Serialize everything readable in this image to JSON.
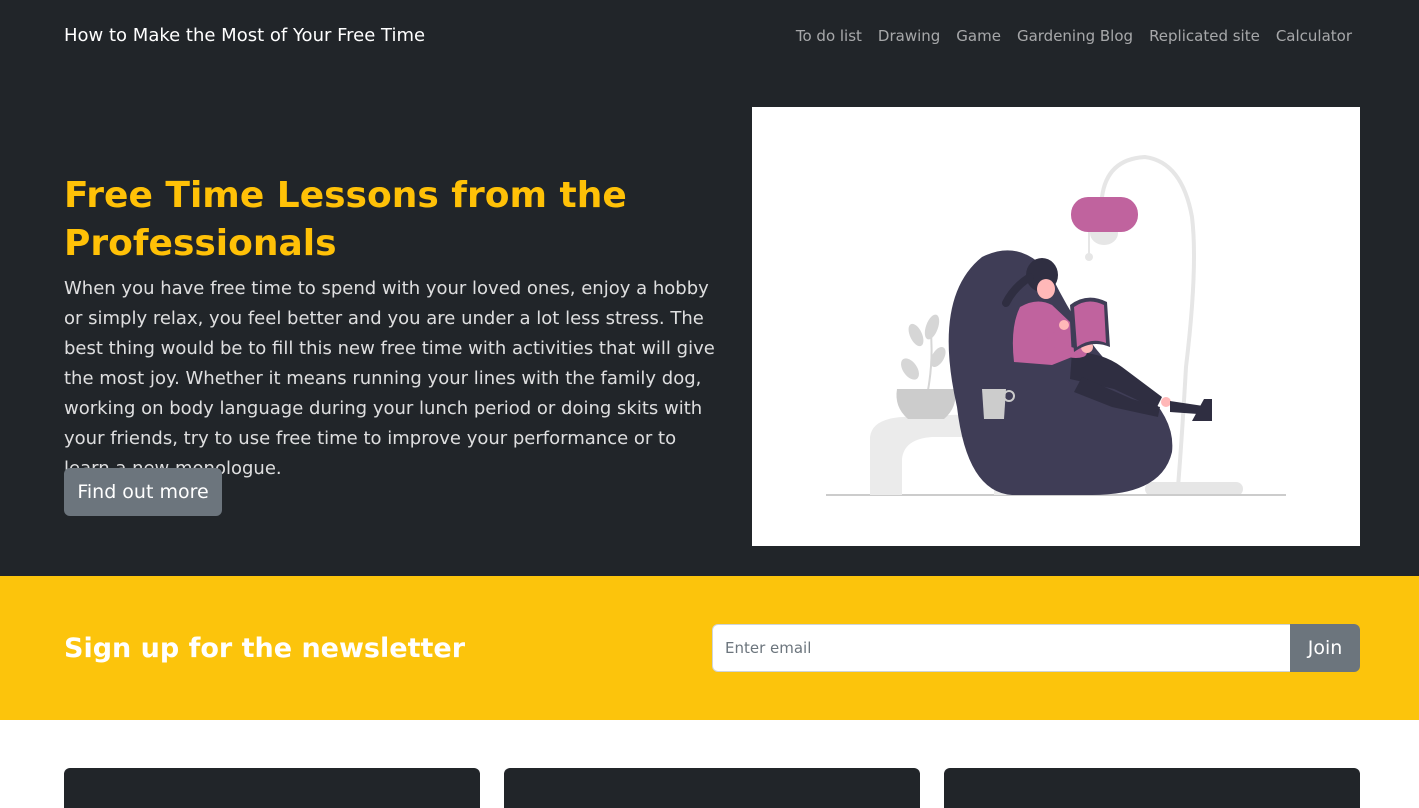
{
  "navbar": {
    "brand": "How to Make the Most of Your Free Time",
    "links": [
      "To do list",
      "Drawing",
      "Game",
      "Gardening Blog",
      "Replicated site",
      "Calculator"
    ]
  },
  "hero": {
    "title": "Free Time Lessons from the Professionals",
    "text": "When you have free time to spend with your loved ones, enjoy a hobby or simply relax, you feel better and you are under a lot less stress. The best thing would be to fill this new free time with activities that will give the most joy. Whether it means running your lines with the family dog, working on body language during your lunch period or doing skits with your friends, try to use free time to improve your performance or to learn a new monologue.",
    "button": "Find out more"
  },
  "newsletter": {
    "title": "Sign up for the newsletter",
    "placeholder": "Enter email",
    "button": "Join"
  },
  "colors": {
    "dark": "#212529",
    "accent": "#ffc107",
    "banner": "#fcc40c",
    "button": "#6c757d",
    "illustration_pink": "#c0639e",
    "illustration_purple": "#3f3d56"
  }
}
